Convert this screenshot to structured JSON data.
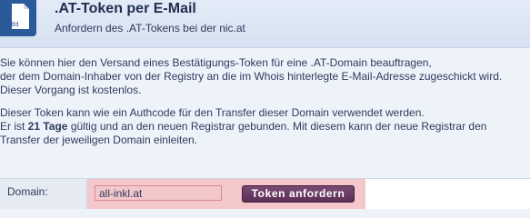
{
  "header": {
    "title": ".AT-Token per E-Mail",
    "subtitle": "Anfordern des .AT-Tokens bei der nic.at",
    "icon": "tld-document-icon",
    "icon_label": ".tld"
  },
  "content": {
    "paragraph1": {
      "line1": "Sie können hier den Versand eines Bestätigungs-Token für eine .AT-Domain beauftragen,",
      "line2": "der dem Domain-Inhaber von der Registry an die im Whois hinterlegte E-Mail-Adresse zugeschickt wird.",
      "line3": "Dieser Vorgang ist kostenlos."
    },
    "paragraph2": {
      "line1": "Dieser Token kann wie ein Authcode für den Transfer dieser Domain verwendet werden.",
      "line2_prefix": "Er ist ",
      "line2_bold": "21 Tage",
      "line2_suffix": " gültig und an den neuen Registrar gebunden. Mit diesem kann der neue Registrar den",
      "line3": "Transfer der jeweiligen Domain einleiten."
    }
  },
  "form": {
    "domain_label": "Domain:",
    "domain_value": "all-inkl.at",
    "submit_label": "Token anfordern"
  },
  "colors": {
    "accent": "#5c2f57",
    "error_bg": "#f4c7cb",
    "header_bg": "#d6e1f1"
  }
}
